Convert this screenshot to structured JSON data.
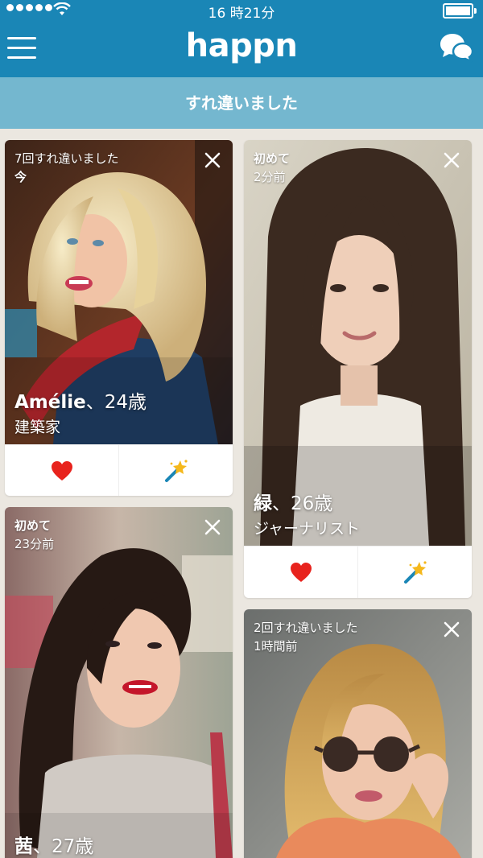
{
  "status_bar": {
    "time": "16 時21分",
    "signal_dots": 5,
    "wifi_icon": "wifi-icon",
    "battery_icon": "battery-icon"
  },
  "header": {
    "logo": "happn",
    "menu_icon": "hamburger-menu-icon",
    "chat_icon": "chat-bubbles-icon",
    "color": "#1a86b6"
  },
  "subheader": {
    "title": "すれ違いました",
    "color": "#74b7cf"
  },
  "cards": [
    {
      "crossings": "7回すれ違いました",
      "when": "今",
      "name": "Amélie",
      "age": "、24歳",
      "job": "建築家",
      "like_icon": "heart-icon",
      "charm_icon": "magic-wand-icon"
    },
    {
      "crossings": "初めて",
      "when": "2分前",
      "name": "緑",
      "age": "、26歳",
      "job": "ジャーナリスト",
      "like_icon": "heart-icon",
      "charm_icon": "magic-wand-icon"
    },
    {
      "crossings": "初めて",
      "when": "23分前",
      "name": "茜",
      "age": "、27歳",
      "job": ""
    },
    {
      "crossings": "2回すれ違いました",
      "when": "1時間前",
      "name": "",
      "age": "",
      "job": ""
    }
  ],
  "colors": {
    "like": "#e8231d",
    "charm": "#f5b81c",
    "background": "#ebe7e0"
  }
}
